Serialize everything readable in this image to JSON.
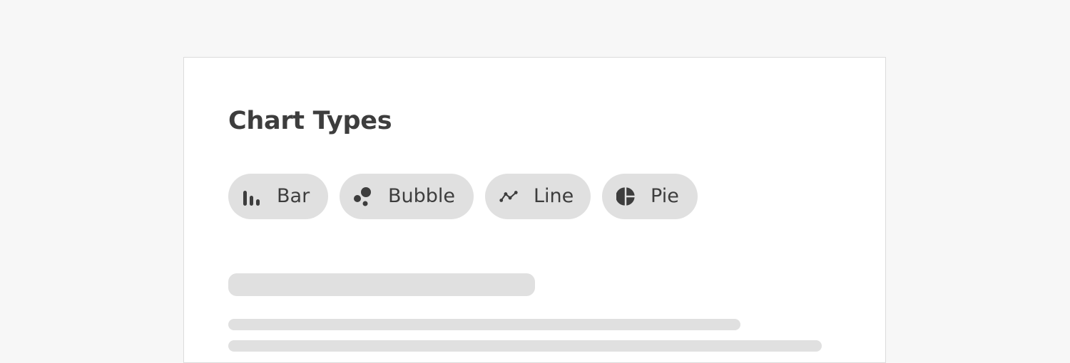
{
  "card": {
    "title": "Chart Types"
  },
  "chips": [
    {
      "label": "Bar",
      "icon": "bar-chart-icon"
    },
    {
      "label": "Bubble",
      "icon": "bubble-chart-icon"
    },
    {
      "label": "Line",
      "icon": "line-chart-icon"
    },
    {
      "label": "Pie",
      "icon": "pie-chart-icon"
    }
  ],
  "colors": {
    "background": "#f7f7f7",
    "card": "#ffffff",
    "chip": "#e0e0e0",
    "text": "#3d3d3d",
    "skeleton": "#e0e0e0"
  }
}
